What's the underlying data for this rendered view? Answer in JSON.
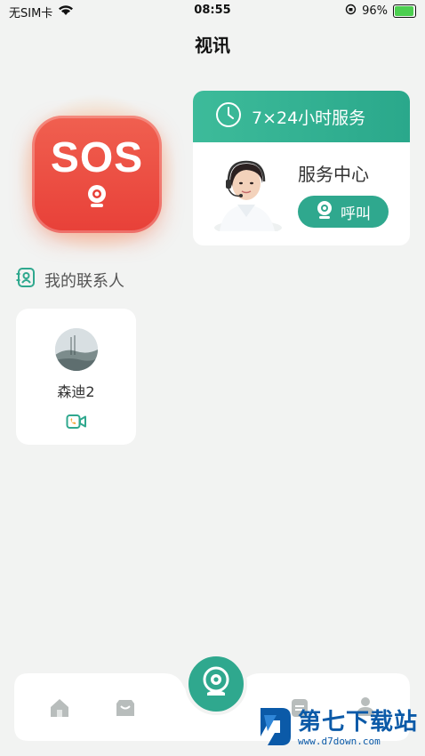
{
  "status_bar": {
    "carrier": "无SIM卡",
    "time": "08:55",
    "battery_percent": "96%"
  },
  "header": {
    "title": "视讯"
  },
  "sos": {
    "label": "SOS"
  },
  "service_card": {
    "header": "7×24小时服务",
    "title": "服务中心",
    "call_label": "呼叫"
  },
  "contacts": {
    "title": "我的联系人",
    "items": [
      {
        "name": "森迪2"
      }
    ]
  },
  "watermark": {
    "main": "第七下载站",
    "sub": "www.d7down.com"
  },
  "colors": {
    "accent": "#2fa88e",
    "sos": "#e84038",
    "background": "#f2f3f2"
  }
}
